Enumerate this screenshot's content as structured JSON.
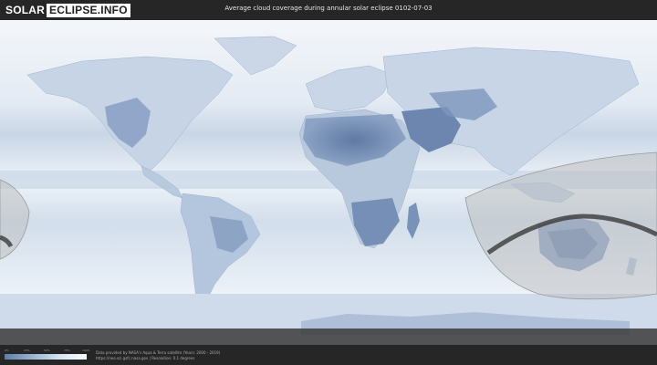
{
  "header": {
    "logo_left": "SOLAR",
    "logo_right": "ECLIPSE.INFO",
    "title": "Average cloud coverage during annular solar eclipse 0102-07-03"
  },
  "legend": {
    "ticks": [
      "0%",
      "25%",
      "50%",
      "75%",
      "100%"
    ],
    "colors": [
      "#5e7da8",
      "#9ab2cf",
      "#d7e3f0",
      "#ffffff"
    ]
  },
  "footer": {
    "credit_line1": "Data provided by NASA's Aqua & Terra satellite (Years: 2000 - 2019)",
    "credit_line2": "https://neo.sci.gsfc.nasa.gov | Resolution: 0.1 degrees"
  },
  "colors": {
    "ocean_cloud": "#e9eff7",
    "land_clear": "#6b84ad",
    "eclipse_zone": "#b9b9b9",
    "path_line": "#3a3a3a"
  }
}
